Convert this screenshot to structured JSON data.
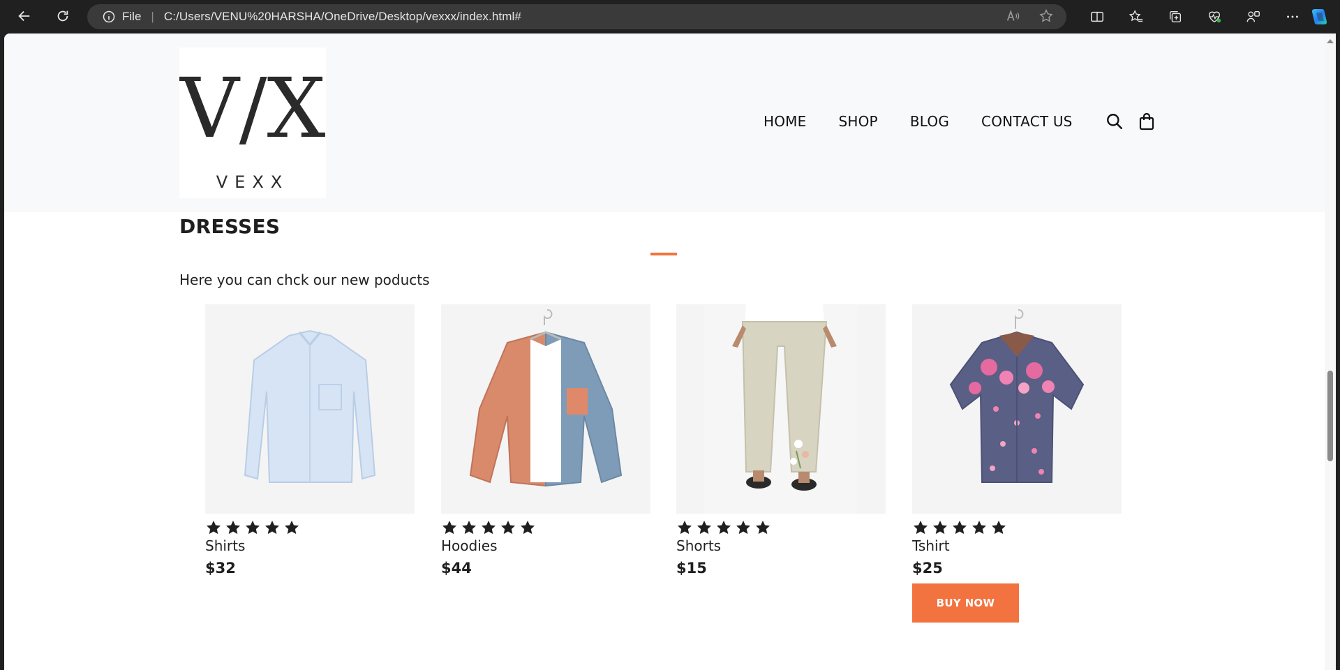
{
  "browser": {
    "protocol_label": "File",
    "url": "C:/Users/VENU%20HARSHA/OneDrive/Desktop/vexxx/index.html#"
  },
  "site": {
    "brand_mark": "V/X",
    "brand_name": "VEXX",
    "nav": [
      {
        "label": "HOME"
      },
      {
        "label": "SHOP"
      },
      {
        "label": "BLOG"
      },
      {
        "label": "CONTACT US"
      }
    ]
  },
  "section": {
    "title": "DRESSES",
    "subtitle": "Here you can chck our new poducts"
  },
  "products": [
    {
      "name": "Shirts",
      "price": "$32",
      "rating": 5,
      "image": "light-blue-shirt"
    },
    {
      "name": "Hoodies",
      "price": "$44",
      "rating": 5,
      "image": "two-tone-corduroy-shirt"
    },
    {
      "name": "Shorts",
      "price": "$15",
      "rating": 5,
      "image": "beige-floral-trousers"
    },
    {
      "name": "Tshirt",
      "price": "$25",
      "rating": 5,
      "image": "navy-floral-shirt",
      "button": "BUY NOW"
    }
  ],
  "colors": {
    "accent": "#f2733f",
    "header_bg": "#f8f9fa",
    "text": "#1f1f1f"
  }
}
